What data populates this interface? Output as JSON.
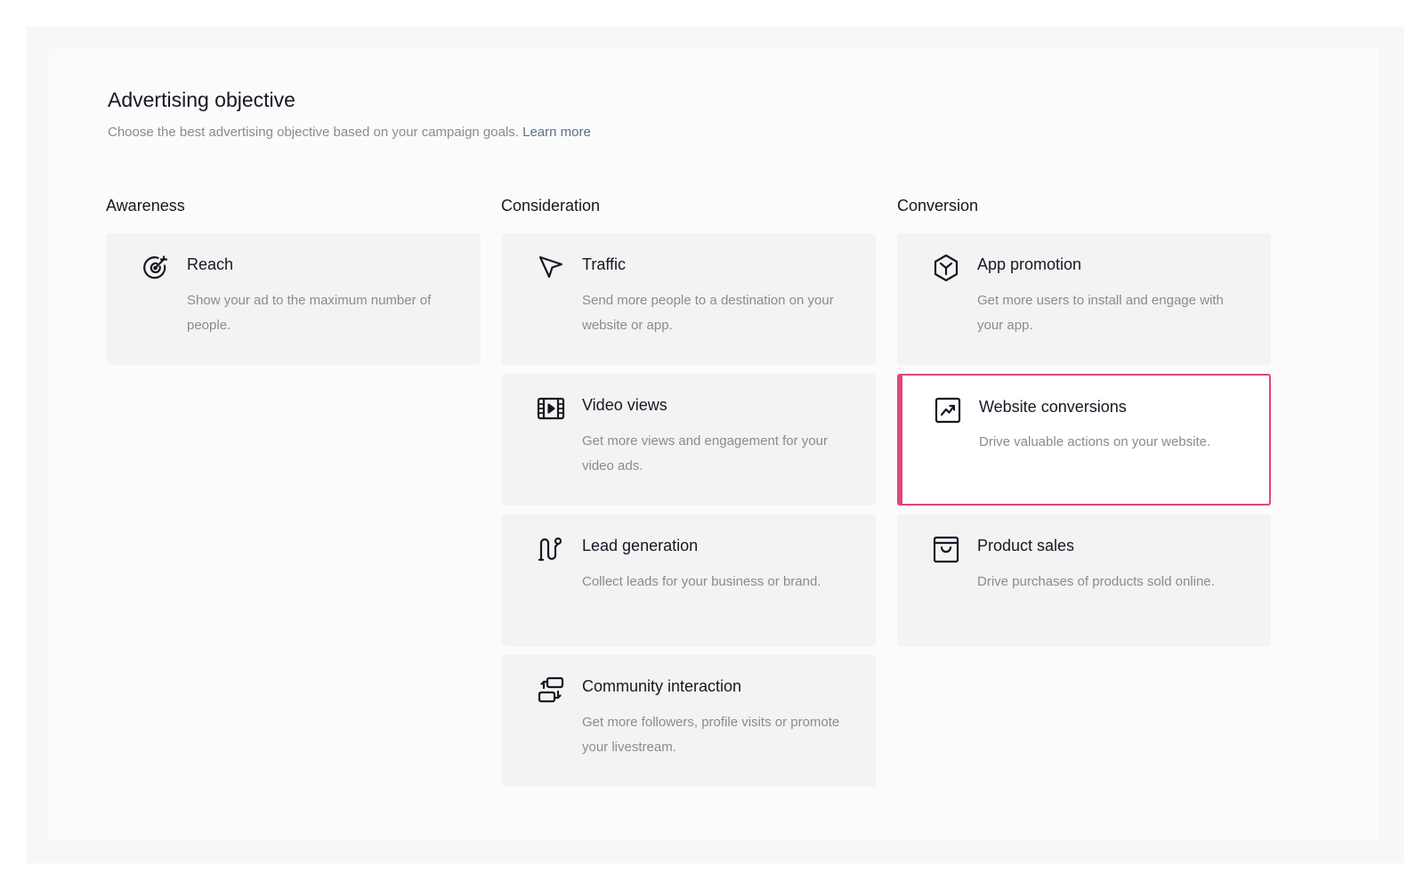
{
  "header": {
    "title": "Advertising objective",
    "subtitle": "Choose the best advertising objective based on your campaign goals.",
    "learn_more": "Learn more"
  },
  "columns": [
    {
      "heading": "Awareness",
      "cards": [
        {
          "icon": "reach-target-icon",
          "title": "Reach",
          "description": "Show your ad to the maximum number of people.",
          "selected": false
        }
      ]
    },
    {
      "heading": "Consideration",
      "cards": [
        {
          "icon": "cursor-pointer-icon",
          "title": "Traffic",
          "description": "Send more people to a destination on your website or app.",
          "selected": false
        },
        {
          "icon": "film-play-icon",
          "title": "Video views",
          "description": "Get more views and engagement for your video ads.",
          "selected": false
        },
        {
          "icon": "lead-funnel-icon",
          "title": "Lead generation",
          "description": "Collect leads for your business or brand.",
          "selected": false
        },
        {
          "icon": "chat-exchange-icon",
          "title": "Community interaction",
          "description": "Get more followers, profile visits or promote your livestream.",
          "selected": false
        }
      ]
    },
    {
      "heading": "Conversion",
      "cards": [
        {
          "icon": "app-cube-icon",
          "title": "App promotion",
          "description": "Get more users to install and engage with your app.",
          "selected": false
        },
        {
          "icon": "trend-chart-icon",
          "title": "Website conversions",
          "description": "Drive valuable actions on your website.",
          "selected": true
        },
        {
          "icon": "shopping-bag-icon",
          "title": "Product sales",
          "description": "Drive purchases of products sold online.",
          "selected": false
        }
      ]
    }
  ],
  "colors": {
    "selected_border": "#e0457b",
    "card_background": "#f3f3f3",
    "text_primary": "#161823",
    "text_secondary": "#8a8b91",
    "link": "#5c6f8a"
  }
}
